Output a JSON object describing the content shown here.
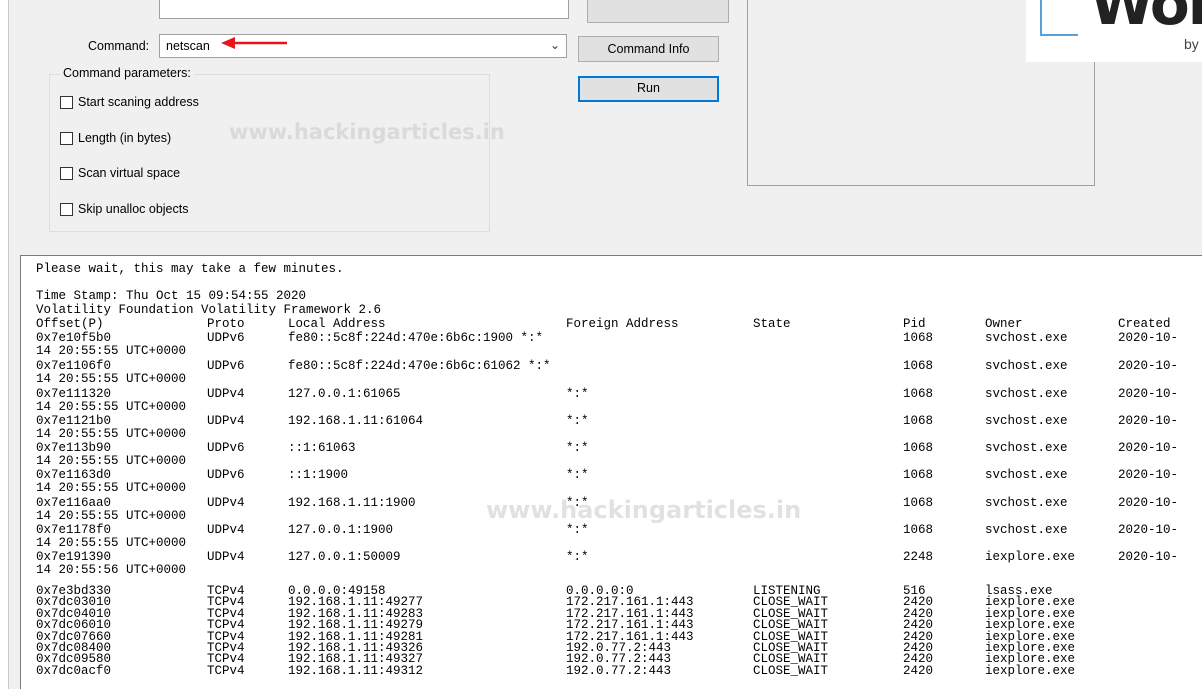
{
  "form": {
    "command_label": "Command:",
    "command_value": "netscan",
    "params_title": "Command parameters:",
    "checkboxes": [
      "Start scaning address",
      "Length (in bytes)",
      "Scan virtual space",
      "Skip unalloc objects"
    ],
    "watermark": "www.hackingarticles.in"
  },
  "buttons": {
    "command_info": "Command Info",
    "run": "Run"
  },
  "logo": {
    "word": "Wor",
    "by": "by"
  },
  "console": {
    "line_wait": "Please wait, this may take a few minutes.",
    "line_timestamp": "Time Stamp: Thu Oct 15 09:54:55 2020",
    "line_framework": "Volatility Foundation Volatility Framework 2.6",
    "headers": {
      "offset": "Offset(P)",
      "proto": "Proto",
      "local": "Local Address",
      "foreign": "Foreign Address",
      "state": "State",
      "pid": "Pid",
      "owner": "Owner",
      "created": "Created"
    },
    "udp_rows": [
      {
        "offset": "0x7e10f5b0",
        "proto": "UDPv6",
        "local": "fe80::5c8f:224d:470e:6b6c:1900 *:*",
        "foreign": "",
        "state": "",
        "pid": "1068",
        "owner": "svchost.exe",
        "created": "2020-10-",
        "cont": "14 20:55:55 UTC+0000"
      },
      {
        "offset": "0x7e1106f0",
        "proto": "UDPv6",
        "local": "fe80::5c8f:224d:470e:6b6c:61062 *:*",
        "foreign": "",
        "state": "",
        "pid": "1068",
        "owner": "svchost.exe",
        "created": "2020-10-",
        "cont": "14 20:55:55 UTC+0000"
      },
      {
        "offset": "0x7e111320",
        "proto": "UDPv4",
        "local": "127.0.0.1:61065",
        "foreign": "*:*",
        "state": "",
        "pid": "1068",
        "owner": "svchost.exe",
        "created": "2020-10-",
        "cont": "14 20:55:55 UTC+0000"
      },
      {
        "offset": "0x7e1121b0",
        "proto": "UDPv4",
        "local": "192.168.1.11:61064",
        "foreign": "*:*",
        "state": "",
        "pid": "1068",
        "owner": "svchost.exe",
        "created": "2020-10-",
        "cont": "14 20:55:55 UTC+0000"
      },
      {
        "offset": "0x7e113b90",
        "proto": "UDPv6",
        "local": "::1:61063",
        "foreign": "*:*",
        "state": "",
        "pid": "1068",
        "owner": "svchost.exe",
        "created": "2020-10-",
        "cont": "14 20:55:55 UTC+0000"
      },
      {
        "offset": "0x7e1163d0",
        "proto": "UDPv6",
        "local": "::1:1900",
        "foreign": "*:*",
        "state": "",
        "pid": "1068",
        "owner": "svchost.exe",
        "created": "2020-10-",
        "cont": "14 20:55:55 UTC+0000"
      },
      {
        "offset": "0x7e116aa0",
        "proto": "UDPv4",
        "local": "192.168.1.11:1900",
        "foreign": "*:*",
        "state": "",
        "pid": "1068",
        "owner": "svchost.exe",
        "created": "2020-10-",
        "cont": "14 20:55:55 UTC+0000"
      },
      {
        "offset": "0x7e1178f0",
        "proto": "UDPv4",
        "local": "127.0.0.1:1900",
        "foreign": "*:*",
        "state": "",
        "pid": "1068",
        "owner": "svchost.exe",
        "created": "2020-10-",
        "cont": "14 20:55:55 UTC+0000"
      },
      {
        "offset": "0x7e191390",
        "proto": "UDPv4",
        "local": "127.0.0.1:50009",
        "foreign": "*:*",
        "state": "",
        "pid": "2248",
        "owner": "iexplore.exe",
        "created": "2020-10-",
        "cont": "14 20:55:56 UTC+0000"
      }
    ],
    "tcp_rows": [
      {
        "offset": "0x7e3bd330",
        "proto": "TCPv4",
        "local": "0.0.0.0:49158",
        "foreign": "0.0.0.0:0",
        "state": "LISTENING",
        "pid": "516",
        "owner": "lsass.exe"
      },
      {
        "offset": "0x7dc03010",
        "proto": "TCPv4",
        "local": "192.168.1.11:49277",
        "foreign": "172.217.161.1:443",
        "state": "CLOSE_WAIT",
        "pid": "2420",
        "owner": "iexplore.exe"
      },
      {
        "offset": "0x7dc04010",
        "proto": "TCPv4",
        "local": "192.168.1.11:49283",
        "foreign": "172.217.161.1:443",
        "state": "CLOSE_WAIT",
        "pid": "2420",
        "owner": "iexplore.exe"
      },
      {
        "offset": "0x7dc06010",
        "proto": "TCPv4",
        "local": "192.168.1.11:49279",
        "foreign": "172.217.161.1:443",
        "state": "CLOSE_WAIT",
        "pid": "2420",
        "owner": "iexplore.exe"
      },
      {
        "offset": "0x7dc07660",
        "proto": "TCPv4",
        "local": "192.168.1.11:49281",
        "foreign": "172.217.161.1:443",
        "state": "CLOSE_WAIT",
        "pid": "2420",
        "owner": "iexplore.exe"
      },
      {
        "offset": "0x7dc08400",
        "proto": "TCPv4",
        "local": "192.168.1.11:49326",
        "foreign": "192.0.77.2:443",
        "state": "CLOSE_WAIT",
        "pid": "2420",
        "owner": "iexplore.exe"
      },
      {
        "offset": "0x7dc09580",
        "proto": "TCPv4",
        "local": "192.168.1.11:49327",
        "foreign": "192.0.77.2:443",
        "state": "CLOSE_WAIT",
        "pid": "2420",
        "owner": "iexplore.exe"
      },
      {
        "offset": "0x7dc0acf0",
        "proto": "TCPv4",
        "local": "192.168.1.11:49312",
        "foreign": "192.0.77.2:443",
        "state": "CLOSE_WAIT",
        "pid": "2420",
        "owner": "iexplore.exe"
      }
    ]
  },
  "colors": {
    "annotation_arrow": "#e8141c",
    "default_button_border": "#0078d7"
  }
}
